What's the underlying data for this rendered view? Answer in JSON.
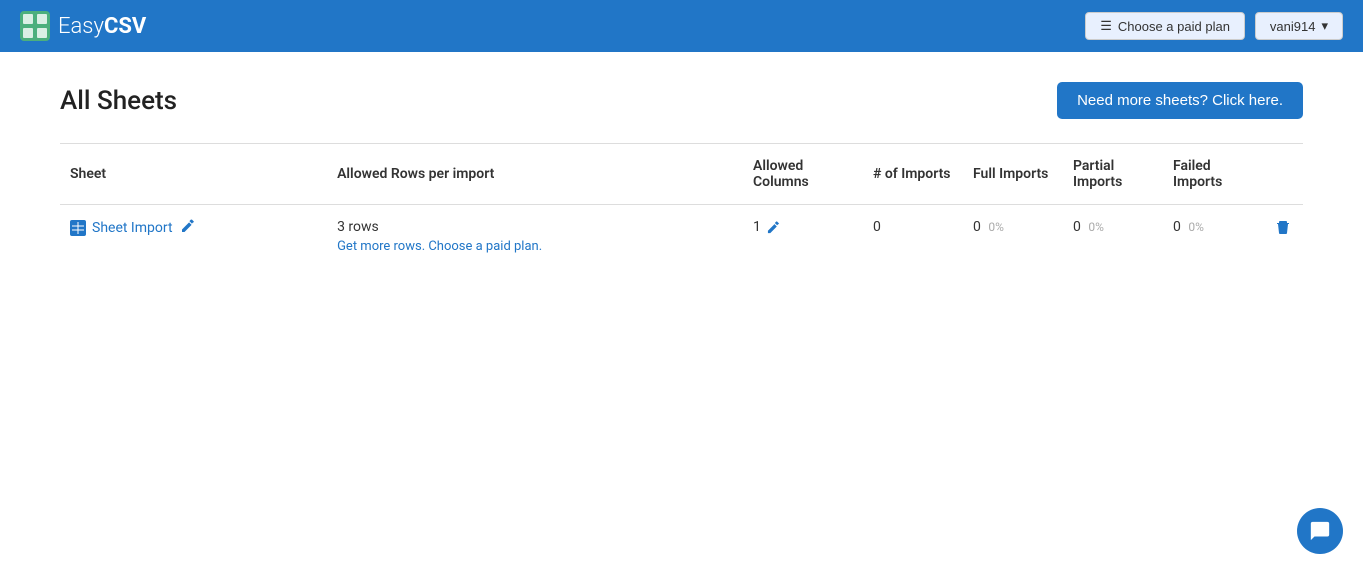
{
  "header": {
    "logo_easy": "Easy",
    "logo_csv": "CSV",
    "paid_plan_icon": "☰",
    "paid_plan_label": "Choose a paid plan",
    "user_label": "vani914",
    "user_dropdown_icon": "▾"
  },
  "main": {
    "page_title": "All Sheets",
    "more_sheets_btn": "Need more sheets? Click here.",
    "table": {
      "columns": [
        {
          "key": "sheet",
          "label": "Sheet"
        },
        {
          "key": "allowed_rows",
          "label": "Allowed Rows per import"
        },
        {
          "key": "allowed_cols",
          "label": "Allowed Columns"
        },
        {
          "key": "num_imports",
          "label": "# of Imports"
        },
        {
          "key": "full_imports",
          "label": "Full Imports"
        },
        {
          "key": "partial_imports",
          "label": "Partial Imports"
        },
        {
          "key": "failed_imports",
          "label": "Failed Imports"
        }
      ],
      "rows": [
        {
          "sheet_name": "Sheet Import",
          "allowed_rows": "3 rows",
          "get_more_rows": "Get more rows. Choose a paid plan.",
          "allowed_cols": "1",
          "num_imports": "0",
          "full_imports": "0",
          "full_pct": "0%",
          "partial_imports": "0",
          "partial_pct": "0%",
          "failed_imports": "0",
          "failed_pct": "0%"
        }
      ]
    }
  },
  "chat": {
    "icon": "💬"
  }
}
